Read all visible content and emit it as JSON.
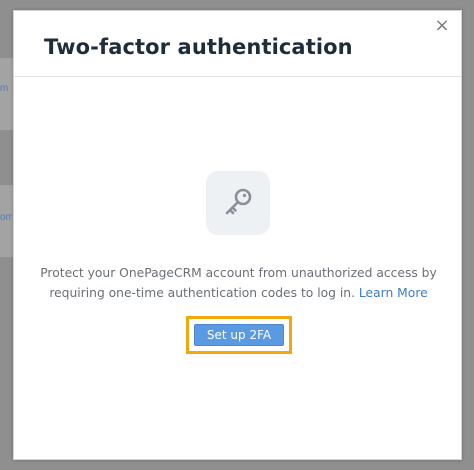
{
  "background": {
    "link_fragments": [
      "m",
      "om"
    ]
  },
  "modal": {
    "title": "Two-factor authentication",
    "close_glyph": "×",
    "icon": "key-icon",
    "description": "Protect your OnePageCRM account from unauthorized access by requiring one-time authentication codes to log in.",
    "learn_more": "Learn More",
    "setup_button": "Set up 2FA"
  },
  "colors": {
    "accent": "#5a9ae3",
    "highlight": "#f2a80a",
    "link": "#3f7cc7",
    "title": "#1f2d3a"
  }
}
